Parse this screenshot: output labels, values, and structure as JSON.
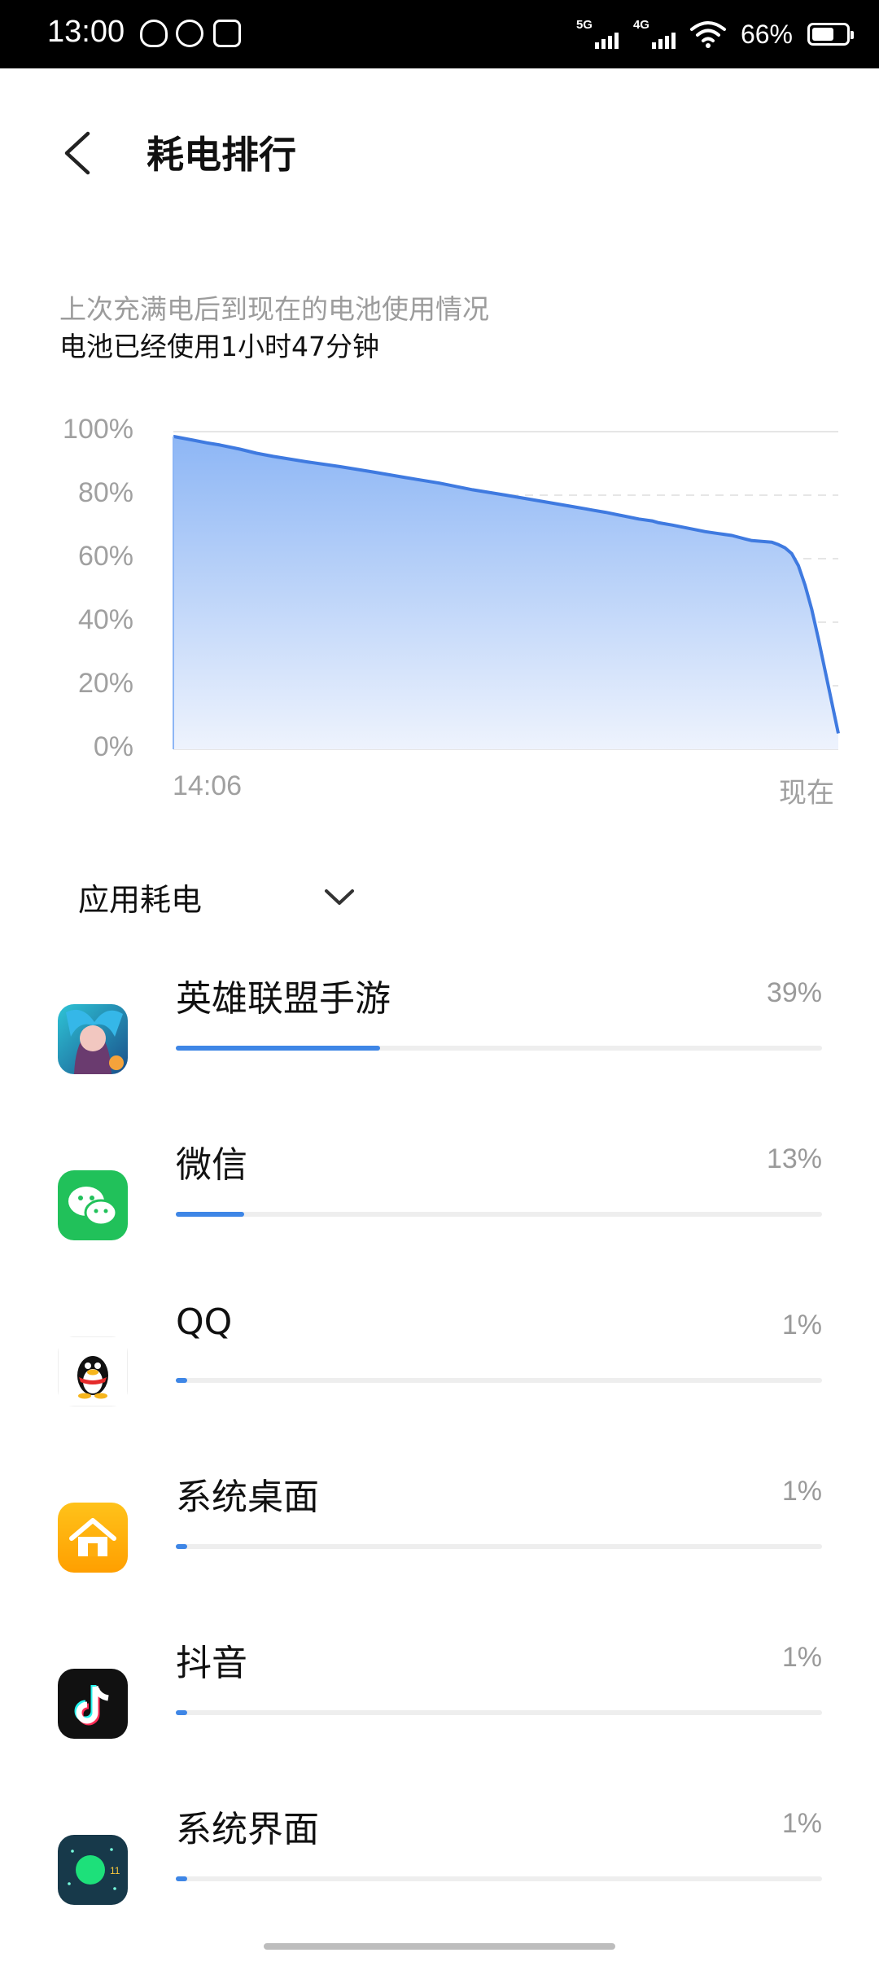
{
  "status_bar": {
    "time": "13:00",
    "notification_icons": [
      "cat-icon",
      "wechat-icon",
      "sim-icon"
    ],
    "signal_1_label": "5G",
    "signal_2_label": "4G",
    "battery_text": "66%",
    "battery_level": 0.66
  },
  "header": {
    "back_icon": "chevron-left-icon",
    "title": "耗电排行"
  },
  "summary": {
    "line1": "上次充满电后到现在的电池使用情况",
    "line2": "电池已经使用1小时47分钟"
  },
  "chart_data": {
    "type": "area",
    "title": "",
    "xlabel": "",
    "ylabel": "",
    "ylim": [
      0,
      100
    ],
    "yticks": [
      "100%",
      "80%",
      "60%",
      "40%",
      "20%",
      "0%"
    ],
    "x_labels": [
      "14:06",
      "现在"
    ],
    "grid": true,
    "series": [
      {
        "x": [
          0,
          3,
          5,
          7,
          10,
          12.5,
          15,
          20,
          25,
          30,
          35,
          40,
          45,
          50,
          55,
          60,
          62,
          63,
          65,
          70,
          72,
          73,
          75,
          80,
          82,
          84,
          86,
          87,
          90,
          91,
          92,
          93,
          94,
          95,
          96,
          97,
          100
        ],
        "y": [
          98.5,
          97.3,
          96.5,
          95.8,
          94.5,
          93.2,
          92.2,
          90.5,
          89,
          87.3,
          85.5,
          83.8,
          81.7,
          80,
          78.2,
          76.4,
          75.7,
          75.3,
          74.6,
          72.5,
          71.9,
          71.3,
          70.6,
          68.5,
          67.9,
          67.3,
          66.2,
          65.7,
          65.2,
          64.4,
          63.4,
          61.6,
          57.8,
          51.7,
          44.1,
          34.8,
          5
        ]
      }
    ],
    "colors": {
      "line": "#3f7ae0",
      "fill_top": "#8db6f5",
      "fill_bottom": "#eef3fd"
    }
  },
  "section": {
    "label": "应用耗电",
    "chevron_icon": "chevron-down-icon"
  },
  "apps": [
    {
      "name": "英雄联盟手游",
      "percent_text": "39%",
      "level": 0.39,
      "icon": "lol-wild-rift-icon"
    },
    {
      "name": "微信",
      "percent_text": "13%",
      "level": 0.13,
      "icon": "wechat-icon"
    },
    {
      "name": "QQ",
      "percent_text": "1%",
      "level": 0.01,
      "icon": "qq-penguin-icon"
    },
    {
      "name": "系统桌面",
      "percent_text": "1%",
      "level": 0.01,
      "icon": "home-icon"
    },
    {
      "name": "抖音",
      "percent_text": "1%",
      "level": 0.01,
      "icon": "douyin-icon"
    },
    {
      "name": "系统界面",
      "percent_text": "1%",
      "level": 0.01,
      "icon": "system-ui-icon"
    }
  ]
}
